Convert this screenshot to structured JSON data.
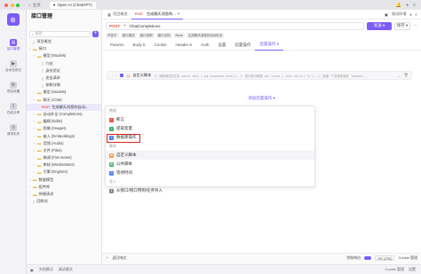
{
  "titlebar": {
    "tabs": [
      {
        "label": "主页"
      },
      {
        "label": "Open AI (ChatGPT)"
      }
    ],
    "colors": {
      "close": "#ff5f57",
      "min": "#febc2e",
      "max": "#28c840"
    }
  },
  "leftnav": {
    "items": [
      {
        "label": "接口管理",
        "icon": "api-icon"
      },
      {
        "label": "自动化测试",
        "icon": "test-icon"
      },
      {
        "label": "项目设置",
        "icon": "settings-icon"
      },
      {
        "label": "在线分享",
        "icon": "share-icon"
      },
      {
        "label": "请求历史",
        "icon": "history-icon"
      }
    ]
  },
  "tree": {
    "title": "接口管理",
    "search_placeholder": "搜索",
    "items": [
      {
        "label": "项目概览",
        "kind": "file",
        "indent": 0
      },
      {
        "label": "接口",
        "kind": "folder",
        "indent": 0
      },
      {
        "label": "模型 (Models)",
        "kind": "folder",
        "indent": 1
      },
      {
        "label": "介绍",
        "kind": "file",
        "indent": 2
      },
      {
        "label": "身份验证",
        "kind": "file",
        "indent": 2
      },
      {
        "label": "发出请求",
        "kind": "file",
        "indent": 2
      },
      {
        "label": "参数详情",
        "kind": "file",
        "indent": 2
      },
      {
        "label": "模型 (Models)",
        "kind": "folder",
        "indent": 1
      },
      {
        "label": "聊天 (Chat)",
        "kind": "folder",
        "indent": 1
      },
      {
        "label": "生成聊天消息的自动...",
        "kind": "post",
        "indent": 2,
        "selected": true
      },
      {
        "label": "自动补全 (Completions)",
        "kind": "folder",
        "indent": 1
      },
      {
        "label": "编辑 (Edits)",
        "kind": "folder",
        "indent": 1
      },
      {
        "label": "图像 (Images)",
        "kind": "folder",
        "indent": 1
      },
      {
        "label": "嵌入 (Embeddings)",
        "kind": "folder",
        "indent": 1
      },
      {
        "label": "音频 (Audio)",
        "kind": "folder",
        "indent": 1
      },
      {
        "label": "文件 (Files)",
        "kind": "folder",
        "indent": 1
      },
      {
        "label": "微调 (Fine-tunes)",
        "kind": "folder",
        "indent": 1
      },
      {
        "label": "审核 (Moderations)",
        "kind": "folder",
        "indent": 1
      },
      {
        "label": "引擎 (Engines)",
        "kind": "folder",
        "indent": 1
      },
      {
        "label": "数据模型",
        "kind": "folder",
        "indent": 0
      },
      {
        "label": "组件库",
        "kind": "folder",
        "indent": 0
      },
      {
        "label": "快捷请求",
        "kind": "folder",
        "indent": 0
      },
      {
        "label": "回收站",
        "kind": "file",
        "indent": 0
      }
    ]
  },
  "tabs": [
    {
      "label": "项目概览",
      "method": ""
    },
    {
      "label": "生成聊天消息的...",
      "method": "POST"
    }
  ],
  "env": {
    "label": "测试环境"
  },
  "request": {
    "method": "POST",
    "url": "/chat/completions",
    "send_label": "发送",
    "save_label": "保存"
  },
  "chips": [
    "开发中",
    "接口描述",
    "接口说明",
    "接口文档",
    "Mock",
    "生成聊天消息的自动补全"
  ],
  "req_tabs": [
    {
      "label": "Params"
    },
    {
      "label": "Body 5"
    },
    {
      "label": "Cookie"
    },
    {
      "label": "Header 6"
    },
    {
      "label": "Auth"
    },
    {
      "label": "设置"
    },
    {
      "label": "前置操作"
    },
    {
      "label": "后置操作 5",
      "active": true
    }
  ],
  "op_row": {
    "label": "自定义脚本",
    "code": "// 获取响应的文本 const text = pm.response.text(); // 按行拆分数据 var lines = text.split('\\n'); // 创建一个变量来保存 \"answer..."
  },
  "add_op_label": "添加后置操作 ▾",
  "menu": {
    "group1": "数据",
    "items1": [
      {
        "label": "断言",
        "icon": "assert-icon",
        "color": "#e8543f"
      },
      {
        "label": "提取变量",
        "icon": "extract-icon",
        "color": "#3fb26b"
      },
      {
        "label": "数据库操作",
        "icon": "database-icon",
        "color": "#4a7cf0"
      }
    ],
    "group2": "脚本",
    "items2": [
      {
        "label": "自定义脚本",
        "icon": "script-icon",
        "color": "#f09a3f",
        "highlight": true
      },
      {
        "label": "公共脚本",
        "icon": "public-script-icon",
        "color": "#3fb26b"
      },
      {
        "label": "等待时间",
        "icon": "clock-icon",
        "color": "#4a7cf0"
      }
    ],
    "group3": "导入",
    "items3": [
      {
        "label": "从接口/接口用例/任务导入",
        "icon": "import-icon",
        "color": "#888888"
      }
    ]
  },
  "statusbar": {
    "left": "返回响应",
    "right_items": [
      "控制响应",
      "OK (200)",
      "Cookie 管理"
    ]
  },
  "bottombar": {
    "items": [
      "文档模式",
      "调试模式"
    ],
    "right": [
      "Cookie 管理",
      "设置"
    ]
  }
}
